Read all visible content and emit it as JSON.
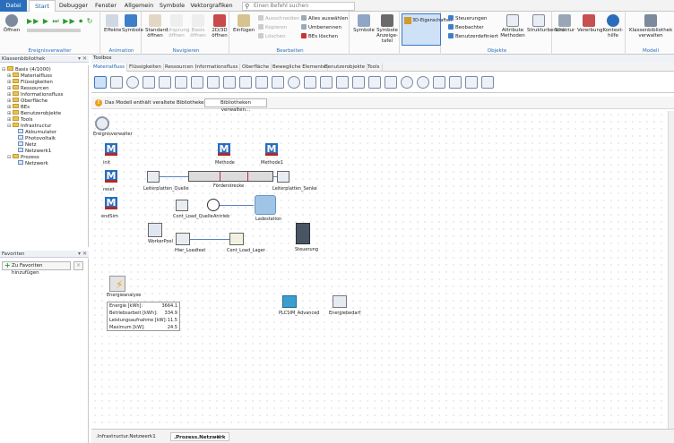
{
  "tabs": [
    "Datei",
    "Start",
    "Debugger",
    "Fenster",
    "Allgemein",
    "Symbole",
    "Vektorgrafiken"
  ],
  "search_placeholder": "Einen Befehl suchen",
  "ribbon": {
    "groups": {
      "ereignis": "Ereignisverwalter",
      "animation": "Animation",
      "navigieren": "Navigieren",
      "bearbeiten": "Bearbeiten",
      "objekte": "Objekte",
      "modell": "Modell"
    },
    "offnen": "Öffnen",
    "effects": "Effekte",
    "symbols": "Symbole",
    "standard": "Standard öffnen",
    "ursprung": "Ursprung öffnen",
    "basis": "Basis öffnen",
    "zoom": "2D/3D öffnen",
    "paste": "Einfügen",
    "cut": "Ausschneiden",
    "copy": "Kopieren",
    "delete": "Löschen",
    "select_all": "Alles auswählen",
    "rename": "Umbenennen",
    "del_bes": "BEs löschen",
    "symbols_anz": "Symbole Anzeige-tafel",
    "props3d": "3D-Eigenschaften",
    "controls": "Steuerungen",
    "observers": "Beobachter",
    "userattr": "Benutzerdefiniert",
    "attr": "Attribute Methoden",
    "struct": "Strukturbericht",
    "structure": "Struktur",
    "inherit": "Vererbung",
    "context": "Kontext-hilfe",
    "classlib": "Klassenbibliothek verwalten"
  },
  "panels": {
    "lib_title": "Klassenbibliothek",
    "fav_title": "Favoriten",
    "fav_add": "Zu Favoriten hinzufügen",
    "fav_x": "×",
    "pin": "▾ ✕"
  },
  "tree": {
    "root": "Basis (4/1000)",
    "items": [
      "Materialfluss",
      "Flüssigkeiten",
      "Ressourcen",
      "Informationsfluss",
      "Oberfläche",
      "BEs",
      "Benutzerobjekte",
      "Tools",
      "Infrastructur",
      "Akkumulator",
      "Photovoltaik",
      "Netz",
      "Netzwerk1",
      "Prozess",
      "Netzwerk"
    ]
  },
  "toolbox": {
    "title": "Toolbox",
    "tabs": [
      "Materialfluss",
      "Flüssigkeiten",
      "Ressourcen",
      "Informationsfluss",
      "Oberfläche",
      "Bewegliche Elemente",
      "Benutzerobjekte",
      "Tools"
    ]
  },
  "info": {
    "icon": "!",
    "text": "Das Modell enthält veraltete Bibliotheken.",
    "button": "Bibliotheken verwalten..."
  },
  "canvas": {
    "ereignisverwalter": "Ereignisverwalter",
    "m1": "init",
    "m2": "reset",
    "m3": "endSim",
    "m4": "Methode",
    "m5": "Methode1",
    "m_letter": "M",
    "quelle": "Leiterplatten_Quelle",
    "foerder": "Förderstrecke",
    "senke": "Leiterplatten_Senke",
    "cont_quelle": "Cont_Load_Quelle",
    "antrieb": "Antrieb",
    "ladestation": "Ladestation",
    "workerpool": "WorkerPool",
    "loadtest": "Hier_Loadtest",
    "lager": "Cont_Load_Lager",
    "steuerung": "Steuerung",
    "energie": "Energieanalyse",
    "plcsim": "PLCSIM_Advanced",
    "energiebedarf": "Energiebedarf",
    "table": [
      {
        "k": "Energie [kWh]:",
        "v": "3664.1"
      },
      {
        "k": "Betriebsarbeit [kWh]:",
        "v": "334.9"
      },
      {
        "k": "Leistungsaufnahme [kW]:",
        "v": "11.5"
      },
      {
        "k": "Maximum [kW]:",
        "v": "24.5"
      }
    ]
  },
  "bottom_tabs": [
    ".Infrastructur.Netzwerk1",
    ".Prozess.Netzwerk"
  ],
  "bottom_close": "×"
}
